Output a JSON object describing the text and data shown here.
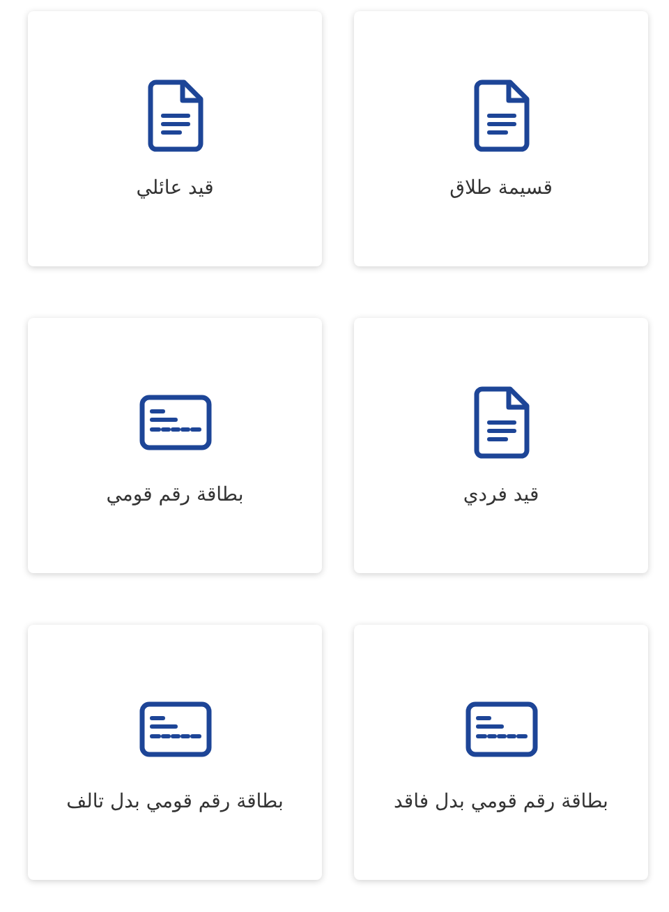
{
  "services": [
    {
      "kind": "document",
      "label": "قسيمة طلاق"
    },
    {
      "kind": "document",
      "label": "قيد عائلي"
    },
    {
      "kind": "document",
      "label": "قيد فردي"
    },
    {
      "kind": "id-card",
      "label": "بطاقة رقم قومي"
    },
    {
      "kind": "id-card",
      "label": "بطاقة رقم قومي بدل فاقد"
    },
    {
      "kind": "id-card",
      "label": "بطاقة رقم قومي بدل تالف"
    }
  ]
}
